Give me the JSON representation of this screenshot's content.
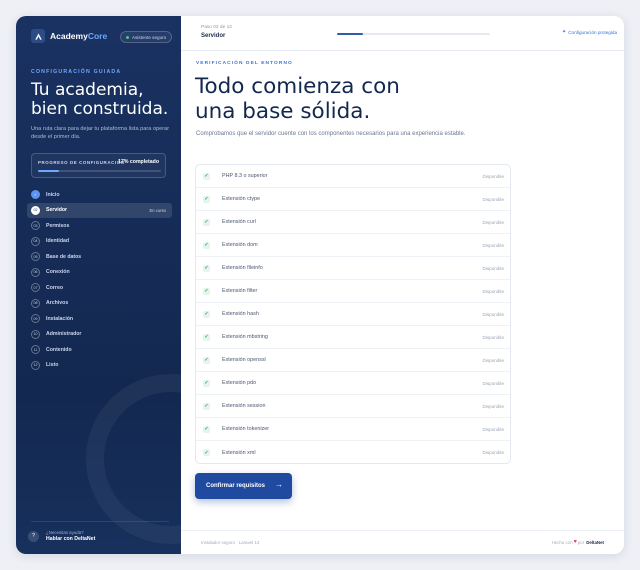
{
  "sidebar": {
    "brand_first": "Academy",
    "brand_second": "Core",
    "secure_pill": "Asistente seguro",
    "eyebrow": "CONFIGURACIÓN GUIADA",
    "headline_line1": "Tu academia,",
    "headline_line2": "bien construida.",
    "subtitle": "Una ruta clara para dejar tu plataforma lista para operar desde el primer día.",
    "progress": {
      "label": "PROGRESO DE CONFIGURACIÓN",
      "percent_text": "17% completado",
      "value": 0.17
    },
    "steps": [
      {
        "num": "✓",
        "label": "Inicio",
        "state": "done"
      },
      {
        "num": "02",
        "label": "Servidor",
        "state": "current",
        "badge": "En curso"
      },
      {
        "num": "03",
        "label": "Permisos",
        "state": "pending"
      },
      {
        "num": "04",
        "label": "Identidad",
        "state": "pending"
      },
      {
        "num": "05",
        "label": "Base de datos",
        "state": "pending"
      },
      {
        "num": "06",
        "label": "Conexión",
        "state": "pending"
      },
      {
        "num": "07",
        "label": "Correo",
        "state": "pending"
      },
      {
        "num": "08",
        "label": "Archivos",
        "state": "pending"
      },
      {
        "num": "09",
        "label": "Instalación",
        "state": "pending"
      },
      {
        "num": "10",
        "label": "Administrador",
        "state": "pending"
      },
      {
        "num": "11",
        "label": "Contenido",
        "state": "pending"
      },
      {
        "num": "12",
        "label": "Listo",
        "state": "pending"
      }
    ],
    "help_glyph": "?",
    "help_question": "¿Necesitas ayuda?",
    "help_link": "Hablar con DeltaNet"
  },
  "topbar": {
    "step_counter": "Paso 02 de 12",
    "step_title": "Servidor",
    "progress_value": 0.17,
    "secure_label": "Configuración protegida"
  },
  "main": {
    "eyebrow": "VERIFICACIÓN DEL ENTORNO",
    "headline_line1": "Todo comienza con",
    "headline_line2": "una base sólida.",
    "intro": "Comprobamos que el servidor cuente con los componentes necesarios para una experiencia estable.",
    "requirements": [
      {
        "name": "PHP 8.3 o superior",
        "status": "Disponible"
      },
      {
        "name": "Extensión ctype",
        "status": "Disponible"
      },
      {
        "name": "Extensión curl",
        "status": "Disponible"
      },
      {
        "name": "Extensión dom",
        "status": "Disponible"
      },
      {
        "name": "Extensión fileinfo",
        "status": "Disponible"
      },
      {
        "name": "Extensión filter",
        "status": "Disponible"
      },
      {
        "name": "Extensión hash",
        "status": "Disponible"
      },
      {
        "name": "Extensión mbstring",
        "status": "Disponible"
      },
      {
        "name": "Extensión openssl",
        "status": "Disponible"
      },
      {
        "name": "Extensión pdo",
        "status": "Disponible"
      },
      {
        "name": "Extensión session",
        "status": "Disponible"
      },
      {
        "name": "Extensión tokenizer",
        "status": "Disponible"
      },
      {
        "name": "Extensión xml",
        "status": "Disponible"
      }
    ],
    "cta_label": "Confirmar requisitos",
    "cta_arrow": "→"
  },
  "footer": {
    "left": "Instalador seguro · Laravel 13",
    "right_prefix": "Hecho con",
    "right_heart": "♥",
    "right_mid": "por",
    "right_company": "DeltaNet"
  },
  "icons": {
    "brand": "academy-logo-icon",
    "check": "check-icon",
    "shield": "shield-icon",
    "arrow": "arrow-right-icon",
    "help": "help-icon"
  },
  "colors": {
    "sidebar_bg": "#1a3262",
    "accent": "#3a72d6",
    "cta_bg": "#1f4aa0",
    "success": "#2ea866",
    "heart": "#e0344a"
  }
}
